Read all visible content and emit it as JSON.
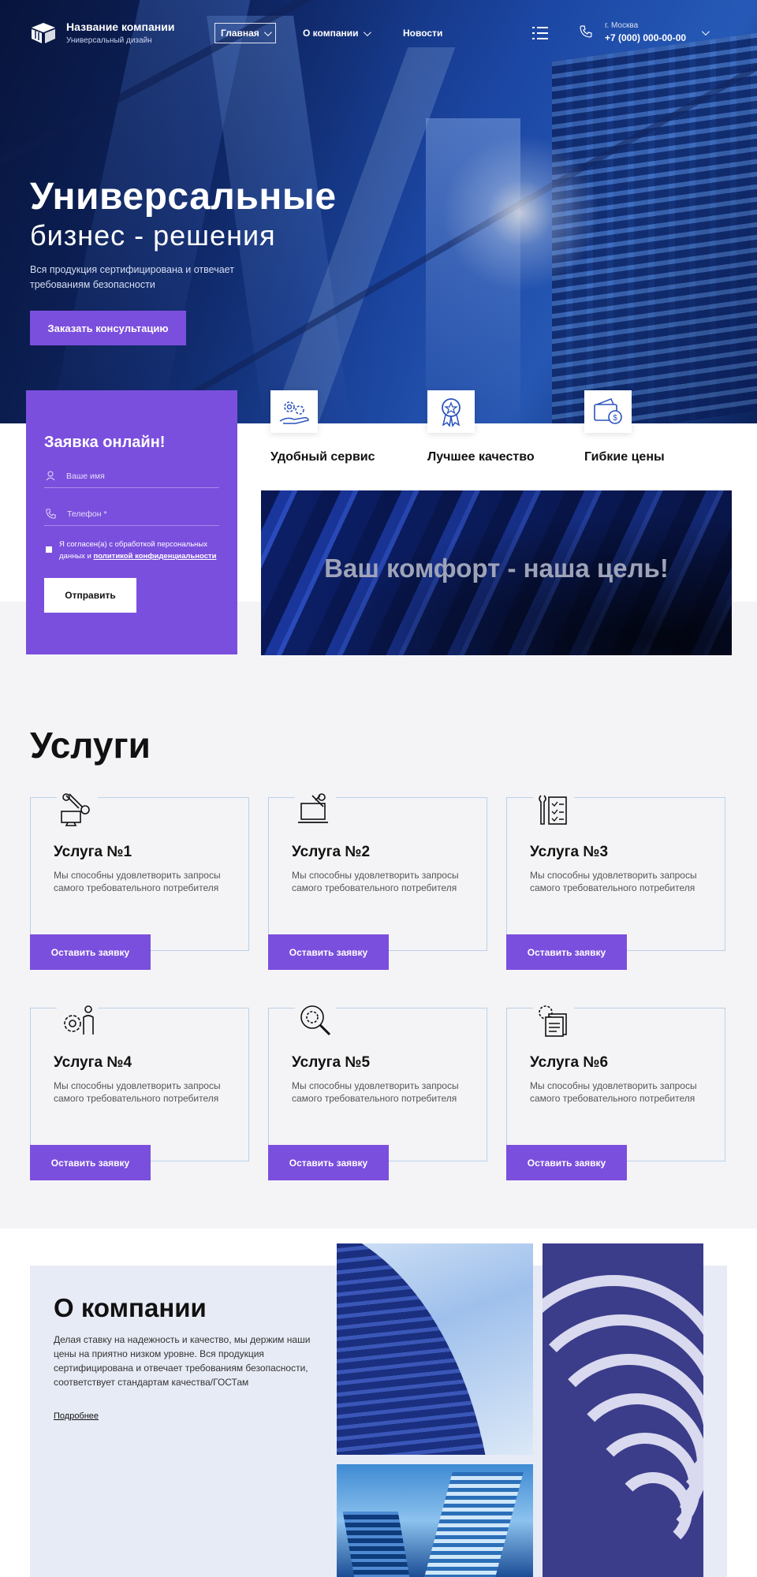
{
  "header": {
    "company_name": "Название компании",
    "company_sub": "Универсальный дизайн",
    "nav": [
      {
        "label": "Главная",
        "dropdown": true,
        "active": true
      },
      {
        "label": "О компании",
        "dropdown": true,
        "active": false
      },
      {
        "label": "Новости",
        "dropdown": false,
        "active": false
      }
    ],
    "city": "г. Москва",
    "phone": "+7 (000) 000-00-00",
    "icons": [
      "logo-cube-icon",
      "menu-list-icon",
      "phone-icon",
      "chevron-down-icon"
    ]
  },
  "hero": {
    "title": "Универсальные",
    "subtitle": "бизнес - решения",
    "description": "Вся продукция сертифицирована и отвечает требованиям безопасности",
    "cta": "Заказать консультацию"
  },
  "form": {
    "title": "Заявка онлайн!",
    "name_placeholder": "Ваше имя",
    "phone_placeholder": "Телефон *",
    "agree_text": "Я согласен(а) с обработкой персональных данных и",
    "agree_link": "политикой конфиденциальности",
    "submit": "Отправить"
  },
  "features": [
    {
      "label": "Удобный сервис",
      "icon": "gears-hand-icon"
    },
    {
      "label": "Лучшее качество",
      "icon": "award-ribbon-icon"
    },
    {
      "label": "Гибкие цены",
      "icon": "wallet-coin-icon"
    }
  ],
  "banner": {
    "text": "Ваш комфорт - наша цель!"
  },
  "services": {
    "title": "Услуги",
    "button_label": "Оставить заявку",
    "items": [
      {
        "title": "Услуга №1",
        "desc": "Мы способны удовлетворить запросы самого требовательного потребителя",
        "icon": "robot-arm-monitor-icon"
      },
      {
        "title": "Услуга №2",
        "desc": "Мы способны удовлетворить запросы самого требовательного потребителя",
        "icon": "laptop-tools-icon"
      },
      {
        "title": "Услуга №3",
        "desc": "Мы способны удовлетворить запросы самого требовательного потребителя",
        "icon": "wrench-checklist-icon"
      },
      {
        "title": "Услуга №4",
        "desc": "Мы способны удовлетворить запросы самого требовательного потребителя",
        "icon": "gear-person-icon"
      },
      {
        "title": "Услуга №5",
        "desc": "Мы способны удовлетворить запросы самого требовательного потребителя",
        "icon": "gear-magnifier-icon"
      },
      {
        "title": "Услуга №6",
        "desc": "Мы способны удовлетворить запросы самого требовательного потребителя",
        "icon": "gear-document-icon"
      }
    ]
  },
  "about": {
    "title": "О компании",
    "text": "Делая ставку на надежность и качество, мы держим наши цены на приятно низком уровне. Вся продукция сертифицирована и отвечает требованиям безопасности, соответствует стандартам качества/ГОСТам",
    "link": "Подробнее"
  },
  "colors": {
    "accent": "#7b4fdd",
    "hero_blue": "#1f4fb5",
    "light_bg": "#f4f4f6",
    "about_bg": "#e7ebf5",
    "frame_border": "#bcd0ea"
  }
}
